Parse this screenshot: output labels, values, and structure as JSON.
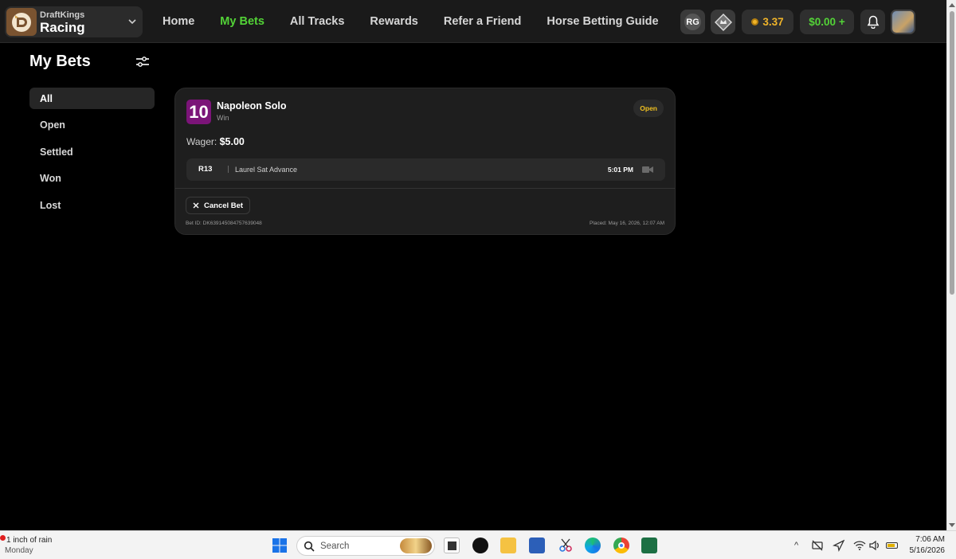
{
  "brand": {
    "top": "DraftKings",
    "main": "Racing"
  },
  "nav": {
    "items": [
      "Home",
      "My Bets",
      "All Tracks",
      "Rewards",
      "Refer a Friend",
      "Horse Betting Guide"
    ],
    "active_index": 1
  },
  "header": {
    "rg_label": "RG",
    "coins": "3.37",
    "balance": "$0.00 +"
  },
  "colors": {
    "accent_green": "#53d337",
    "coin_gold": "#f0b429",
    "open_status": "#f0c020",
    "program_purple": "#7b1478"
  },
  "page": {
    "title": "My Bets"
  },
  "sidebar": {
    "items": [
      "All",
      "Open",
      "Settled",
      "Won",
      "Lost"
    ],
    "active_index": 0
  },
  "bet": {
    "program_number": "10",
    "horse": "Napoleon Solo",
    "type": "Win",
    "status": "Open",
    "wager_label": "Wager:",
    "wager_amount": "$5.00",
    "race_number": "R13",
    "track": "Laurel Sat Advance",
    "post_time": "5:01 PM",
    "cancel_label": "Cancel Bet",
    "bet_id": "Bet ID: DK639145084757639048",
    "placed": "Placed: May 16, 2026, 12:07 AM"
  },
  "taskbar": {
    "weather_line1": "1 inch of rain",
    "weather_line2": "Monday",
    "search_placeholder": "Search",
    "time": "7:06 AM",
    "date": "5/16/2026"
  }
}
